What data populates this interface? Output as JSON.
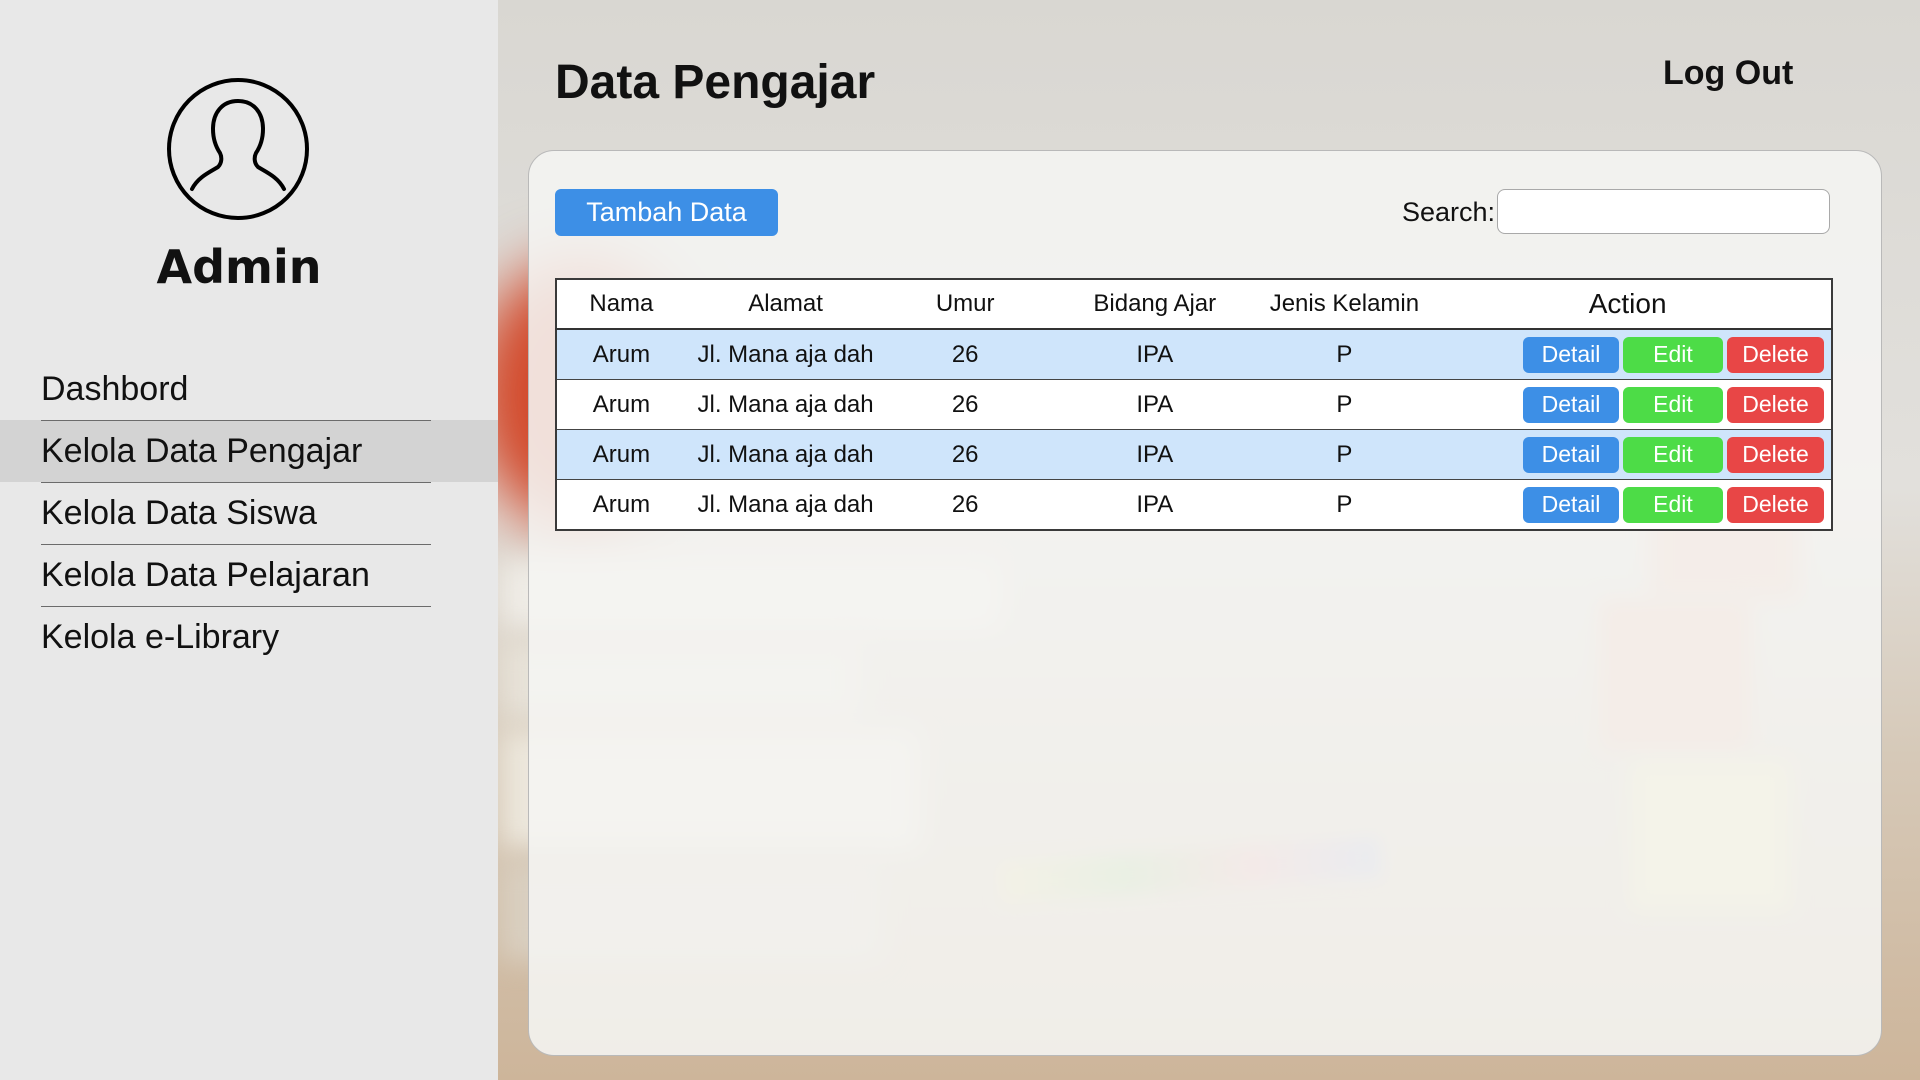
{
  "sidebar": {
    "user_name": "Admin",
    "menu": [
      {
        "label": "Dashbord"
      },
      {
        "label": "Kelola Data Pengajar",
        "active": true
      },
      {
        "label": "Kelola Data Siswa"
      },
      {
        "label": "Kelola Data Pelajaran"
      },
      {
        "label": "Kelola e-Library"
      }
    ]
  },
  "header": {
    "title": "Data Pengajar",
    "logout_label": "Log Out"
  },
  "toolbar": {
    "add_label": "Tambah Data",
    "search_label": "Search:",
    "search_value": ""
  },
  "table": {
    "columns": [
      "Nama",
      "Alamat",
      "Umur",
      "Bidang Ajar",
      "Jenis Kelamin",
      "Action"
    ],
    "rows": [
      {
        "nama": "Arum",
        "alamat": "Jl. Mana aja dah",
        "umur": "26",
        "bidang": "IPA",
        "jk": "P"
      },
      {
        "nama": "Arum",
        "alamat": "Jl. Mana aja dah",
        "umur": "26",
        "bidang": "IPA",
        "jk": "P"
      },
      {
        "nama": "Arum",
        "alamat": "Jl. Mana aja dah",
        "umur": "26",
        "bidang": "IPA",
        "jk": "P"
      },
      {
        "nama": "Arum",
        "alamat": "Jl. Mana aja dah",
        "umur": "26",
        "bidang": "IPA",
        "jk": "P"
      }
    ],
    "actions": {
      "detail": "Detail",
      "edit": "Edit",
      "delete": "Delete"
    }
  },
  "colors": {
    "primary": "#3d8fe6",
    "edit": "#4ddc47",
    "delete": "#e84646",
    "row_highlight": "#cfe5fb",
    "sidebar_bg": "#e8e8e8"
  },
  "icons": {
    "avatar": "user-avatar-icon"
  }
}
